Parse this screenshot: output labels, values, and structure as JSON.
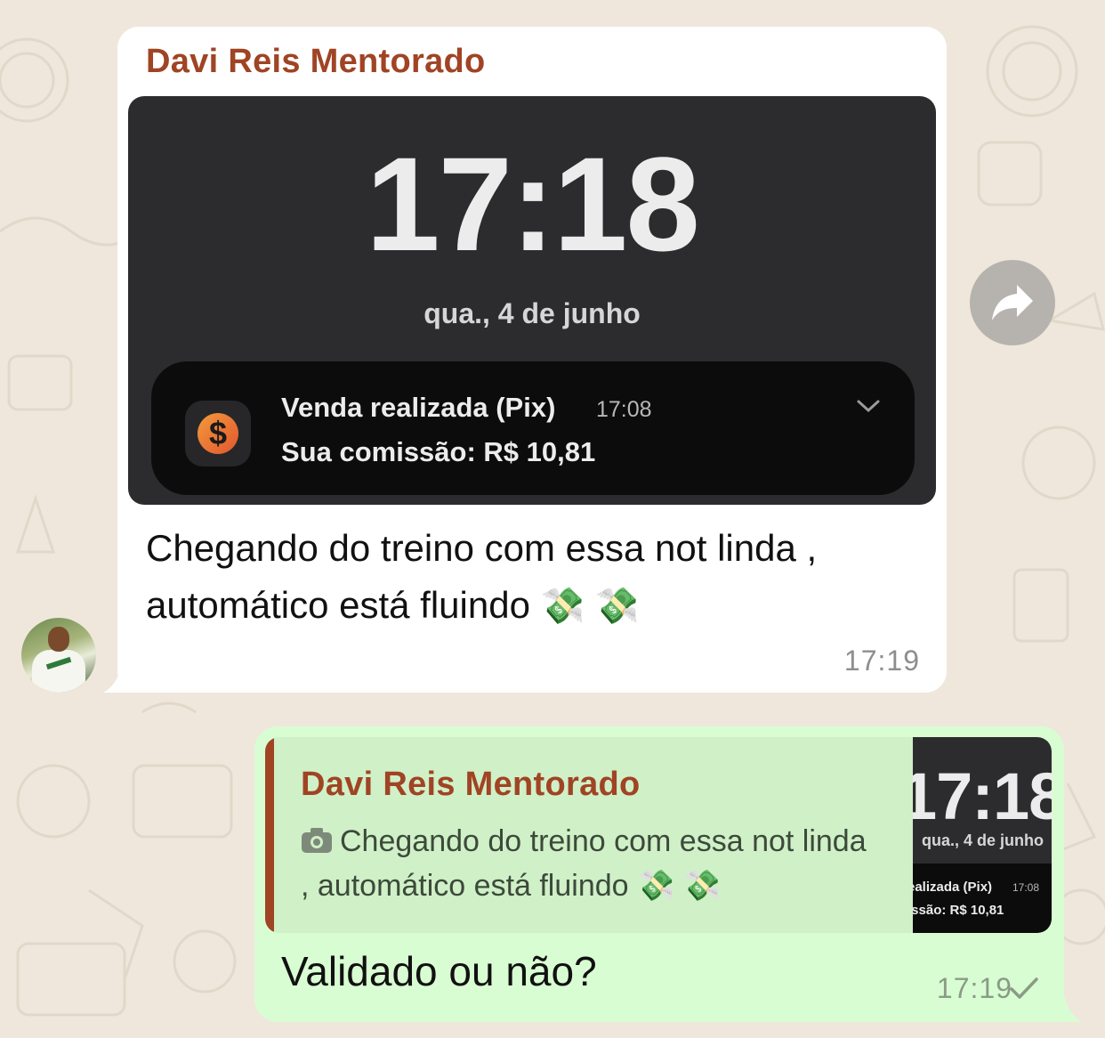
{
  "incoming": {
    "sender": "Davi Reis Mentorado",
    "image": {
      "lock_time": "17:18",
      "lock_date": "qua., 4 de junho",
      "notification": {
        "title": "Venda realizada (Pix)",
        "time": "17:08",
        "body": "Sua comissão: R$ 10,81",
        "app_icon": "dollar-coin-icon"
      }
    },
    "text": "Chegando do treino com essa not linda , automático está fluindo",
    "emoji": "💸 💸",
    "timestamp": "17:19"
  },
  "forward_icon": "forward-arrow-icon",
  "outgoing": {
    "quote": {
      "sender": "Davi Reis Mentorado",
      "text": "Chegando do treino com essa not linda , automático está fluindo",
      "emoji": "💸 💸",
      "thumb": {
        "time": "17:18",
        "date": "qua., 4 de junho",
        "title": "ealizada (Pix)",
        "notif_time": "17:08",
        "body": "issão: R$ 10,81"
      }
    },
    "text": "Validado ou não?",
    "timestamp": "17:19",
    "status_icon": "single-check-icon"
  },
  "colors": {
    "background": "#efe7dc",
    "incoming_bubble": "#ffffff",
    "outgoing_bubble": "#d9fdd3",
    "sender_name": "#a04424"
  }
}
